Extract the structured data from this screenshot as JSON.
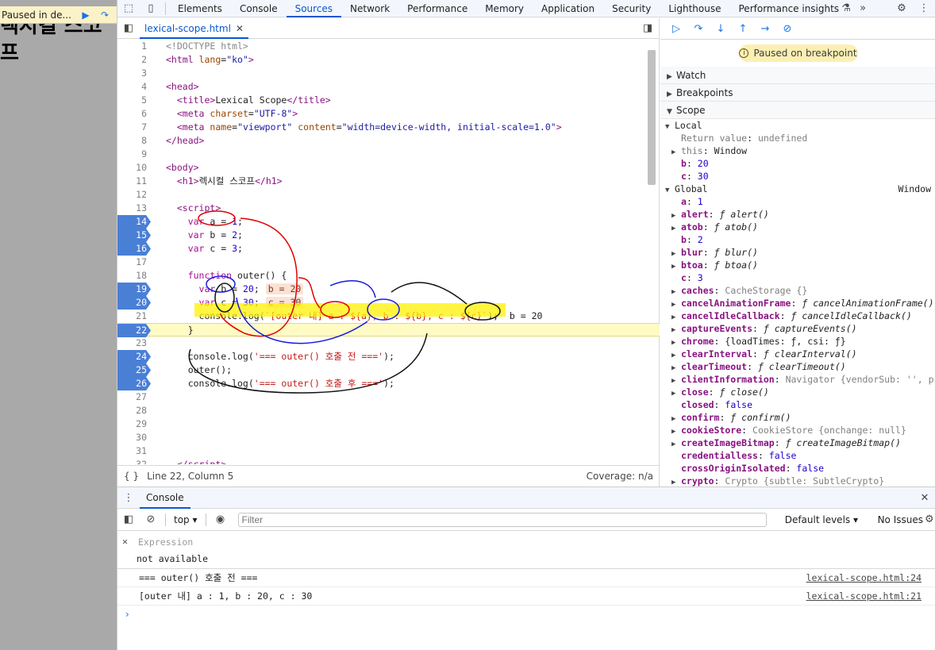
{
  "page": {
    "heading": "렉시컬 스코프",
    "paused_text": "Paused in de..."
  },
  "toolbar": {
    "tabs": [
      "Elements",
      "Console",
      "Sources",
      "Network",
      "Performance",
      "Memory",
      "Application",
      "Security",
      "Lighthouse",
      "Performance insights"
    ],
    "active": "Sources"
  },
  "editor": {
    "file_tab": "lexical-scope.html",
    "lines": [
      {
        "n": "1",
        "html": "<span class='cm'>&lt;!DOCTYPE html&gt;</span>"
      },
      {
        "n": "2",
        "html": "<span class='tag'>&lt;html</span> <span class='attr'>lang</span>=<span class='val'>\"ko\"</span><span class='tag'>&gt;</span>"
      },
      {
        "n": "3",
        "html": ""
      },
      {
        "n": "4",
        "html": "<span class='tag'>&lt;head&gt;</span>"
      },
      {
        "n": "5",
        "html": "  <span class='tag'>&lt;title&gt;</span>Lexical Scope<span class='tag'>&lt;/title&gt;</span>"
      },
      {
        "n": "6",
        "html": "  <span class='tag'>&lt;meta</span> <span class='attr'>charset</span>=<span class='val'>\"UTF-8\"</span><span class='tag'>&gt;</span>"
      },
      {
        "n": "7",
        "html": "  <span class='tag'>&lt;meta</span> <span class='attr'>name</span>=<span class='val'>\"viewport\"</span> <span class='attr'>content</span>=<span class='val'>\"width=device-width, initial-scale=1.0\"</span><span class='tag'>&gt;</span>"
      },
      {
        "n": "8",
        "html": "<span class='tag'>&lt;/head&gt;</span>"
      },
      {
        "n": "9",
        "html": ""
      },
      {
        "n": "10",
        "html": "<span class='tag'>&lt;body&gt;</span>"
      },
      {
        "n": "11",
        "html": "  <span class='tag'>&lt;h1&gt;</span>렉시컬 스코프<span class='tag'>&lt;/h1&gt;</span>"
      },
      {
        "n": "12",
        "html": ""
      },
      {
        "n": "13",
        "html": "  <span class='tag'>&lt;script&gt;</span>"
      },
      {
        "n": "14",
        "bp": true,
        "html": "    <span class='kw'>var</span> a = <span class='num'>1</span>;"
      },
      {
        "n": "15",
        "bp": true,
        "html": "    <span class='kw'>var</span> b = <span class='num'>2</span>;"
      },
      {
        "n": "16",
        "bp": true,
        "html": "    <span class='kw'>var</span> c = <span class='num'>3</span>;"
      },
      {
        "n": "17",
        "html": ""
      },
      {
        "n": "18",
        "html": "    <span class='kw'>function</span> outer() {"
      },
      {
        "n": "19",
        "bp": true,
        "html": "      <span class='kw'>var</span> b = <span class='num'>20</span>;<span class='inl'>b = 20</span>"
      },
      {
        "n": "20",
        "bp": true,
        "html": "      <span class='kw'>var</span> c = <span class='num'>30</span>;<span class='inl'>c = 30</span>"
      },
      {
        "n": "21",
        "html": "      console.log(<span class='str'>`[outer 내] a : ${a}, b : ${b}, c : ${c}`</span>);  b = 20"
      },
      {
        "n": "22",
        "bp": true,
        "cur": true,
        "html": "    }"
      },
      {
        "n": "23",
        "html": ""
      },
      {
        "n": "24",
        "bp": true,
        "html": "    console.log(<span class='str'>'=== outer() 호출 전 ==='</span>);"
      },
      {
        "n": "25",
        "bp": true,
        "html": "    outer();"
      },
      {
        "n": "26",
        "bp": true,
        "html": "    console.log(<span class='str'>'=== outer() 호출 후 ==='</span>);"
      },
      {
        "n": "27",
        "html": ""
      },
      {
        "n": "28",
        "html": ""
      },
      {
        "n": "29",
        "html": ""
      },
      {
        "n": "30",
        "html": ""
      },
      {
        "n": "31",
        "html": ""
      },
      {
        "n": "32",
        "html": "  <span class='tag'>&lt;/script&gt;</span>"
      }
    ],
    "status_left": "Line 22, Column 5",
    "status_right": "Coverage: n/a"
  },
  "debugger": {
    "paused_banner": "Paused on breakpoint",
    "sections": [
      "Watch",
      "Breakpoints",
      "Scope"
    ],
    "scope_rows": [
      {
        "ind": 0,
        "arrow": "▼",
        "k": "Local",
        "kcls": "v",
        "rt": ""
      },
      {
        "ind": 1,
        "arrow": "",
        "k": "Return value",
        "kcls": "kg",
        "sep": ": ",
        "v": "undefined",
        "vcls": "vg"
      },
      {
        "ind": 1,
        "arrow": "▶",
        "k": "this",
        "kcls": "kg",
        "sep": ": ",
        "v": "Window",
        "vcls": "v"
      },
      {
        "ind": 1,
        "arrow": "",
        "k": "b",
        "kcls": "k",
        "sep": ": ",
        "v": "20",
        "vcls": "vn"
      },
      {
        "ind": 1,
        "arrow": "",
        "k": "c",
        "kcls": "k",
        "sep": ": ",
        "v": "30",
        "vcls": "vn"
      },
      {
        "ind": 0,
        "arrow": "▼",
        "k": "Global",
        "kcls": "v",
        "rt": "Window"
      },
      {
        "ind": 1,
        "arrow": "",
        "k": "a",
        "kcls": "k",
        "sep": ": ",
        "v": "1",
        "vcls": "vn"
      },
      {
        "ind": 1,
        "arrow": "▶",
        "k": "alert",
        "kcls": "k",
        "sep": ": ",
        "v": "ƒ alert()",
        "vcls": "vf"
      },
      {
        "ind": 1,
        "arrow": "▶",
        "k": "atob",
        "kcls": "k",
        "sep": ": ",
        "v": "ƒ atob()",
        "vcls": "vf"
      },
      {
        "ind": 1,
        "arrow": "",
        "k": "b",
        "kcls": "k",
        "sep": ": ",
        "v": "2",
        "vcls": "vn"
      },
      {
        "ind": 1,
        "arrow": "▶",
        "k": "blur",
        "kcls": "k",
        "sep": ": ",
        "v": "ƒ blur()",
        "vcls": "vf"
      },
      {
        "ind": 1,
        "arrow": "▶",
        "k": "btoa",
        "kcls": "k",
        "sep": ": ",
        "v": "ƒ btoa()",
        "vcls": "vf"
      },
      {
        "ind": 1,
        "arrow": "",
        "k": "c",
        "kcls": "k",
        "sep": ": ",
        "v": "3",
        "vcls": "vn"
      },
      {
        "ind": 1,
        "arrow": "▶",
        "k": "caches",
        "kcls": "k",
        "sep": ": ",
        "v": "CacheStorage {}",
        "vcls": "vg"
      },
      {
        "ind": 1,
        "arrow": "▶",
        "k": "cancelAnimationFrame",
        "kcls": "k",
        "sep": ": ",
        "v": "ƒ cancelAnimationFrame()",
        "vcls": "vf"
      },
      {
        "ind": 1,
        "arrow": "▶",
        "k": "cancelIdleCallback",
        "kcls": "k",
        "sep": ": ",
        "v": "ƒ cancelIdleCallback()",
        "vcls": "vf"
      },
      {
        "ind": 1,
        "arrow": "▶",
        "k": "captureEvents",
        "kcls": "k",
        "sep": ": ",
        "v": "ƒ captureEvents()",
        "vcls": "vf"
      },
      {
        "ind": 1,
        "arrow": "▶",
        "k": "chrome",
        "kcls": "k",
        "sep": ": ",
        "v": "{loadTimes: ƒ, csi: ƒ}",
        "vcls": "v"
      },
      {
        "ind": 1,
        "arrow": "▶",
        "k": "clearInterval",
        "kcls": "k",
        "sep": ": ",
        "v": "ƒ clearInterval()",
        "vcls": "vf"
      },
      {
        "ind": 1,
        "arrow": "▶",
        "k": "clearTimeout",
        "kcls": "k",
        "sep": ": ",
        "v": "ƒ clearTimeout()",
        "vcls": "vf"
      },
      {
        "ind": 1,
        "arrow": "▶",
        "k": "clientInformation",
        "kcls": "k",
        "sep": ": ",
        "v": "Navigator {vendorSub: '', produ",
        "vcls": "vg"
      },
      {
        "ind": 1,
        "arrow": "▶",
        "k": "close",
        "kcls": "k",
        "sep": ": ",
        "v": "ƒ close()",
        "vcls": "vf"
      },
      {
        "ind": 1,
        "arrow": "",
        "k": "closed",
        "kcls": "k",
        "sep": ": ",
        "v": "false",
        "vcls": "vn"
      },
      {
        "ind": 1,
        "arrow": "▶",
        "k": "confirm",
        "kcls": "k",
        "sep": ": ",
        "v": "ƒ confirm()",
        "vcls": "vf"
      },
      {
        "ind": 1,
        "arrow": "▶",
        "k": "cookieStore",
        "kcls": "k",
        "sep": ": ",
        "v": "CookieStore {onchange: null}",
        "vcls": "vg"
      },
      {
        "ind": 1,
        "arrow": "▶",
        "k": "createImageBitmap",
        "kcls": "k",
        "sep": ": ",
        "v": "ƒ createImageBitmap()",
        "vcls": "vf"
      },
      {
        "ind": 1,
        "arrow": "",
        "k": "credentialless",
        "kcls": "k",
        "sep": ": ",
        "v": "false",
        "vcls": "vn"
      },
      {
        "ind": 1,
        "arrow": "",
        "k": "crossOriginIsolated",
        "kcls": "k",
        "sep": ": ",
        "v": "false",
        "vcls": "vn"
      },
      {
        "ind": 1,
        "arrow": "▶",
        "k": "crypto",
        "kcls": "k",
        "sep": ": ",
        "v": "Crypto {subtle: SubtleCrypto}",
        "vcls": "vg"
      }
    ]
  },
  "console": {
    "tab": "Console",
    "context": "top",
    "filter_placeholder": "Filter",
    "levels": "Default levels",
    "issues": "No Issues",
    "expression_placeholder": "Expression",
    "expression_value": "not available",
    "messages": [
      {
        "text": "=== outer() 호출 전 ===",
        "src": "lexical-scope.html:24"
      },
      {
        "text": "[outer 내] a : 1, b : 20, c : 30",
        "src": "lexical-scope.html:21"
      }
    ],
    "prompt": "›"
  }
}
